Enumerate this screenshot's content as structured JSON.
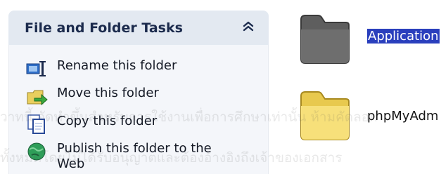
{
  "task_pane": {
    "title": "File and Folder Tasks",
    "collapse_icon": "double-chevron-up-icon",
    "items": [
      {
        "label": "Rename this folder",
        "icon": "rename-folder-icon"
      },
      {
        "label": "Move this folder",
        "icon": "move-folder-icon"
      },
      {
        "label": "Copy this folder",
        "icon": "copy-folder-icon"
      },
      {
        "label": "Publish this folder to the Web",
        "icon": "publish-web-icon"
      }
    ]
  },
  "folders": [
    {
      "name": "Application",
      "selected": true,
      "color": "#6b6b6b"
    },
    {
      "name": "phpMyAdm",
      "selected": false,
      "color": "#f5dc6e"
    }
  ],
  "watermark": {
    "line1": "วาทนี้ จัดทำขึ้นสำหรับการใช้งานเพื่อการศึกษาเท่านั้น ห้ามคัดลอก",
    "line2": "ทั้งหมดโดยไม่ได้รับอนุญาตและต้องอ้างอิงถึงเจ้าของเอกสาร"
  },
  "colors": {
    "header_bg": "#e3e9f1",
    "body_bg": "#f4f6fa",
    "selection": "#2a3fbd"
  }
}
